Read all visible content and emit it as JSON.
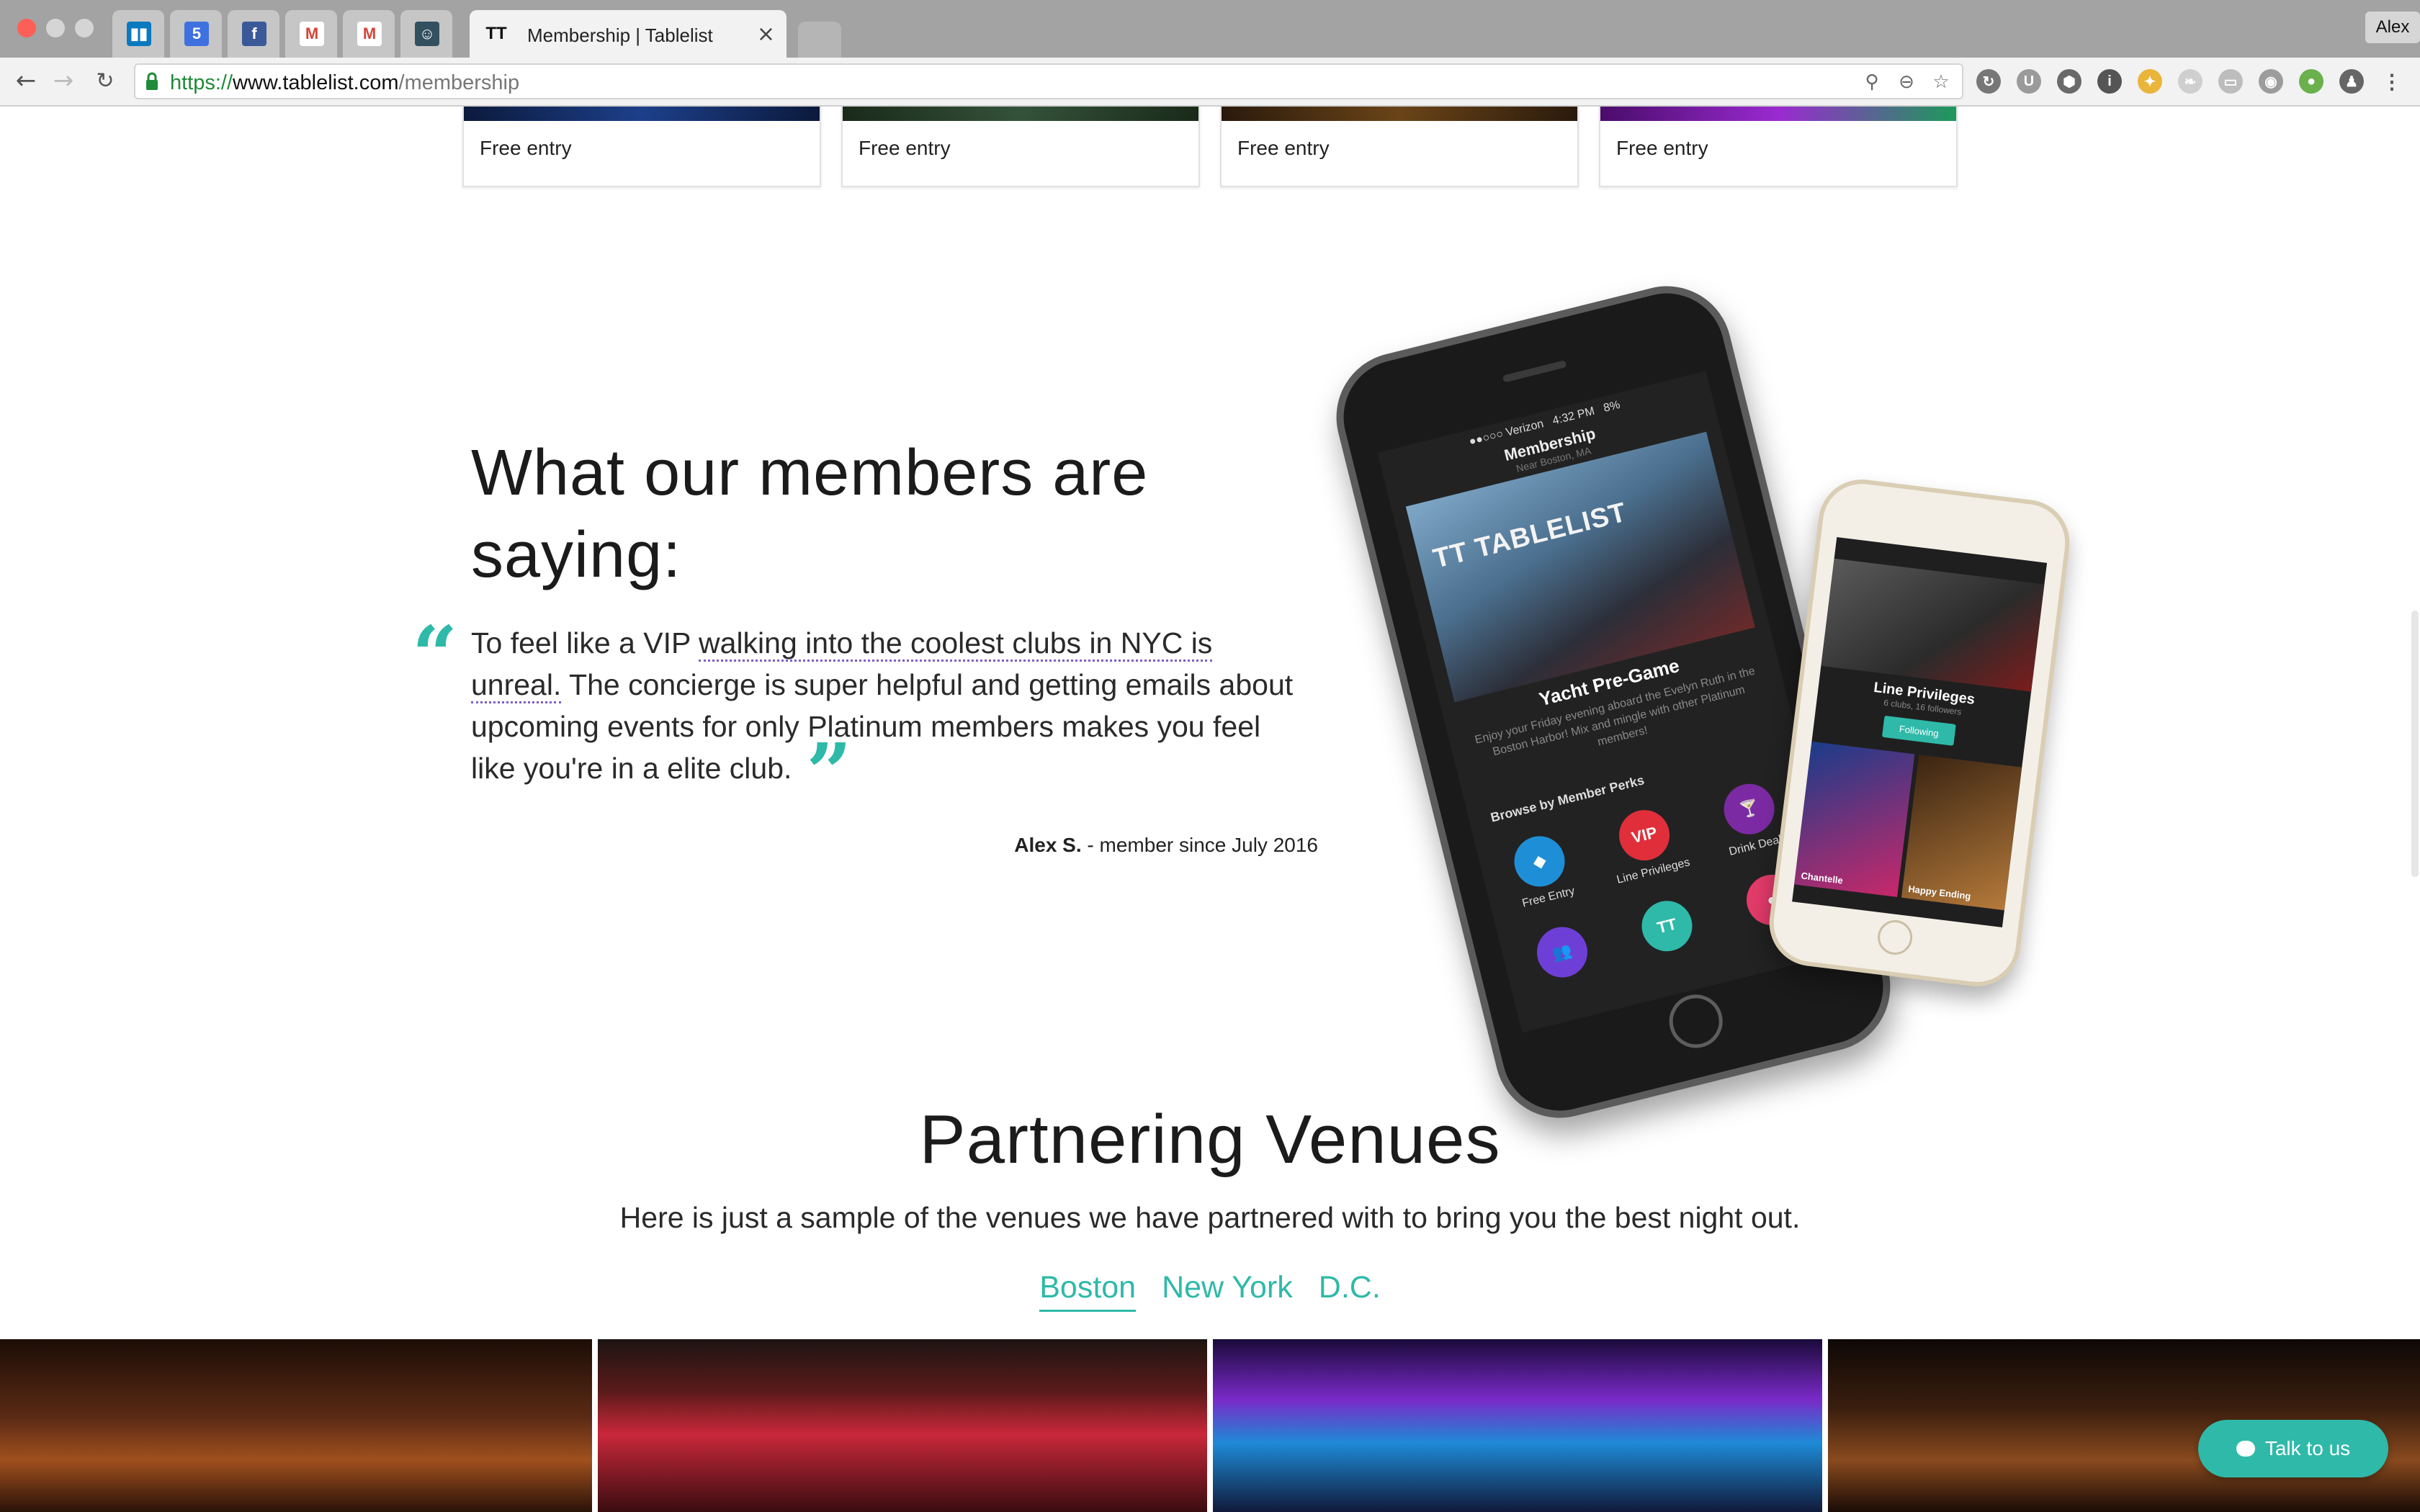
{
  "browser": {
    "tabs": [
      {
        "icon": "trello-icon",
        "color": "#0a79bf"
      },
      {
        "icon": "calendar-icon",
        "color": "#3f70e0",
        "text": "5"
      },
      {
        "icon": "facebook-icon",
        "color": "#3b5998",
        "text": "f"
      },
      {
        "icon": "gmail-icon",
        "color": "#d44638",
        "text": "M"
      },
      {
        "icon": "gmail-icon",
        "color": "#d44638",
        "text": "M"
      },
      {
        "icon": "jenkins-icon",
        "color": "#335061"
      }
    ],
    "active_tab": {
      "title": "Membership | Tablelist"
    },
    "profile_name": "Alex",
    "url": {
      "scheme": "https://",
      "host": "www.tablelist.com",
      "path": "/membership"
    }
  },
  "perks": {
    "cards": [
      {
        "label": "Free entry"
      },
      {
        "label": "Free entry"
      },
      {
        "label": "Free entry"
      },
      {
        "label": "Free entry"
      }
    ]
  },
  "testimonial": {
    "title": "What our members are saying:",
    "quote_start": "To feel like a VIP ",
    "quote_highlight": "walking into the coolest clubs in NYC is unreal.",
    "quote_end": " The concierge is super helpful and getting emails about upcoming events for only Platinum members makes you feel like you're in a elite club.",
    "author": "Alex S.",
    "since": " - member since July 2016"
  },
  "phone_big": {
    "carrier": "●●○○○ Verizon",
    "time": "4:32 PM",
    "battery": "8%",
    "screen_title": "Membership",
    "location": "Near Boston, MA",
    "hero_brand": "TT TABLELIST",
    "event_title": "Yacht Pre-Game",
    "event_desc": "Enjoy your Friday evening aboard the Evelyn Ruth in the Boston Harbor! Mix and mingle with other Platinum members!",
    "browse_label": "Browse by Member Perks",
    "perks": [
      {
        "label": "Free Entry",
        "color": "#1e8fd6"
      },
      {
        "label": "Line Privileges",
        "color": "#e02f3a",
        "text": "VIP"
      },
      {
        "label": "Drink Deals",
        "color": "#7c2aa3"
      }
    ]
  },
  "phone_small": {
    "title": "Line Privileges",
    "subtitle": "6 clubs, 16 followers",
    "button": "Following",
    "venues": [
      {
        "name": "Chantelle"
      },
      {
        "name": "Happy Ending"
      }
    ]
  },
  "venues": {
    "title": "Partnering Venues",
    "subtitle": "Here is just a sample of the venues we have partnered with to bring you the best night out.",
    "cities": [
      {
        "label": "Boston"
      },
      {
        "label": "New York"
      },
      {
        "label": "D.C."
      }
    ]
  },
  "chat": {
    "label": "Talk to us"
  },
  "colors": {
    "accent": "#2fb9a9"
  }
}
